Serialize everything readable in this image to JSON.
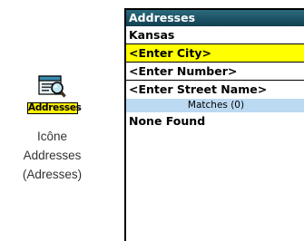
{
  "icon": {
    "name": "addresses-icon",
    "label": "Addresses"
  },
  "caption": {
    "line1": "Icône",
    "line2": "Addresses",
    "line3": "(Adresses)"
  },
  "screen": {
    "title": "Addresses",
    "fields": [
      {
        "value": "Kansas",
        "selected": false
      },
      {
        "value": "<Enter City>",
        "selected": true
      },
      {
        "value": "<Enter Number>",
        "selected": false
      },
      {
        "value": "<Enter Street Name>",
        "selected": false
      }
    ],
    "matches_label": "Matches (0)",
    "results": [
      "None Found"
    ]
  },
  "colors": {
    "titlebar": "#1f5667",
    "selected_row": "#ffff00",
    "matches_bar": "#bcd9f2",
    "icon_label_bg": "#fff000"
  }
}
